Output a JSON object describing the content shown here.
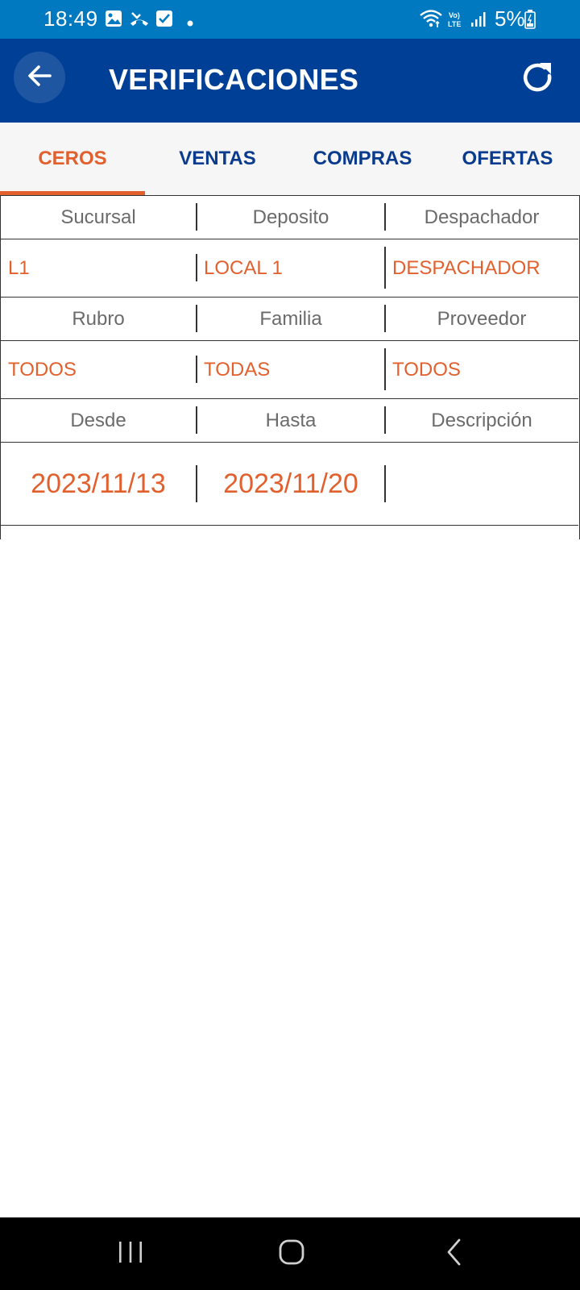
{
  "status_bar": {
    "time": "18:49",
    "battery": "5%",
    "icons": [
      "gallery-icon",
      "missed-call-icon",
      "checkbox-icon",
      "dot-icon",
      "wifi-icon",
      "volte-icon",
      "signal-icon",
      "battery-icon"
    ]
  },
  "app_bar": {
    "title": "VERIFICACIONES",
    "back_icon": "arrow-back-icon",
    "refresh_icon": "refresh-icon",
    "background": "#003f96"
  },
  "tabs": [
    {
      "label": "CEROS",
      "active": true
    },
    {
      "label": "VENTAS",
      "active": false
    },
    {
      "label": "COMPRAS",
      "active": false
    },
    {
      "label": "OFERTAS",
      "active": false
    }
  ],
  "filters": {
    "row1": {
      "headers": [
        "Sucursal",
        "Deposito",
        "Despachador"
      ],
      "values": [
        "L1",
        "LOCAL 1",
        "DESPACHADOR"
      ]
    },
    "row2": {
      "headers": [
        "Rubro",
        "Familia",
        "Proveedor"
      ],
      "values": [
        "TODOS",
        "TODAS",
        "TODOS"
      ]
    },
    "row3": {
      "headers": [
        "Desde",
        "Hasta",
        "Descripción"
      ],
      "values": [
        "2023/11/13",
        "2023/11/20",
        ""
      ]
    }
  },
  "colors": {
    "accent": "#e2602d",
    "primary": "#003f96",
    "status_bar": "#0079c1"
  },
  "nav_bar": {
    "icons": [
      "recent-apps-icon",
      "home-icon",
      "back-nav-icon"
    ]
  }
}
